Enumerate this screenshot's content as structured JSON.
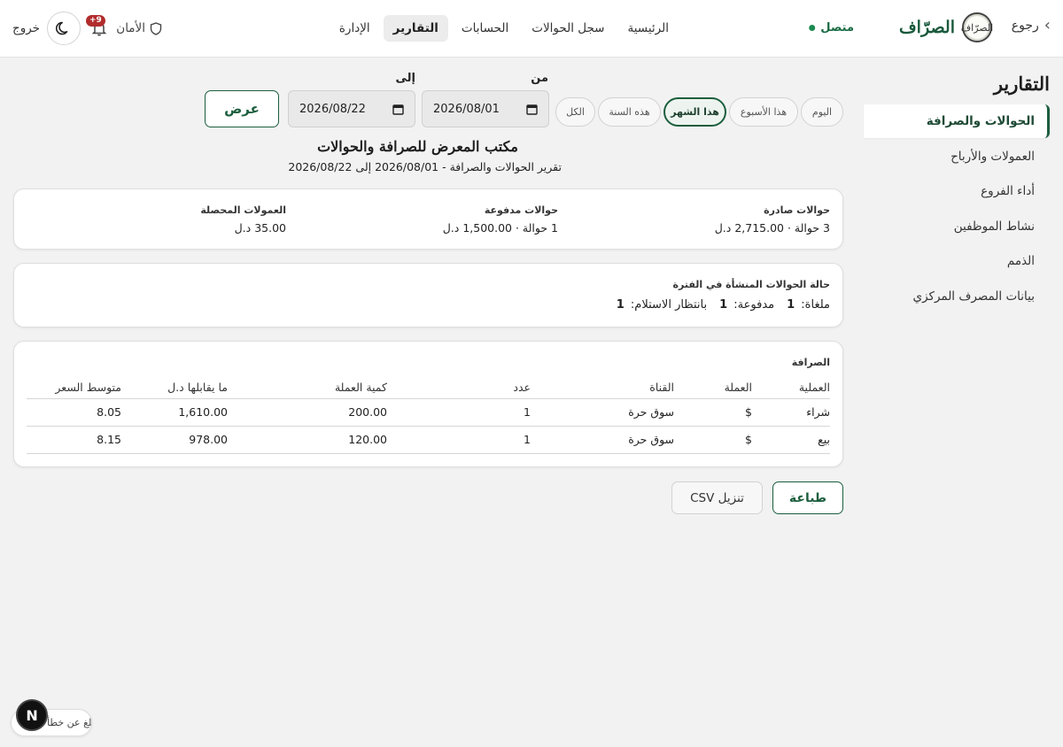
{
  "colors": {
    "brand": "#1c5e3e",
    "online": "#1c8a4f",
    "badge": "#b22c2c",
    "background": "#f2f2f2"
  },
  "topbar": {
    "back_label": "رجوع",
    "back_icon": "chevron-right-icon",
    "logo_text": "الصرّاف",
    "brand_name": "الصرّاف",
    "nav": [
      {
        "label": "الرئيسية"
      },
      {
        "label": "سجل الحوالات"
      },
      {
        "label": "الحسابات"
      },
      {
        "label": "التقارير",
        "active": true
      },
      {
        "label": "الإدارة"
      }
    ],
    "status_label": "متصل",
    "security_label": "الأمان",
    "notifications_badge": "9+",
    "theme_icon": "moon-icon",
    "logout_label": "خروج"
  },
  "sidebar": {
    "title": "التقارير",
    "items": [
      {
        "label": "الحوالات والصرافة",
        "active": true
      },
      {
        "label": "العمولات والأرباح"
      },
      {
        "label": "أداء الفروع"
      },
      {
        "label": "نشاط الموظفين"
      },
      {
        "label": "الذمم"
      },
      {
        "label": "بيانات المصرف المركزي"
      }
    ]
  },
  "filters": {
    "from_label": "من",
    "to_label": "إلى",
    "presets": [
      {
        "label": "اليوم"
      },
      {
        "label": "هذا الأسبوع"
      },
      {
        "label": "هذا الشهر",
        "active": true
      },
      {
        "label": "هذه السنة"
      },
      {
        "label": "الكل"
      }
    ],
    "from_date": "2026/08/01",
    "to_date": "2026/08/22",
    "show_button": "عرض"
  },
  "report": {
    "title": "مكتب المعرض للصرافة والحوالات",
    "subtitle": "تقرير الحوالات والصرافة - 2026/08/01 إلى 2026/08/22"
  },
  "summary": [
    {
      "label": "حوالات صادرة",
      "value": "3 حوالة · 2,715.00 د.ل"
    },
    {
      "label": "حوالات مدفوعة",
      "value": "1 حوالة · 1,500.00 د.ل"
    },
    {
      "label": "العمولات المحصلة",
      "value": "35.00 د.ل"
    }
  ],
  "status_card": {
    "title": "حالة الحوالات المنشأة في الفترة",
    "items": [
      {
        "label": "ملغاة:",
        "value": "1"
      },
      {
        "label": "مدفوعة:",
        "value": "1"
      },
      {
        "label": "بانتظار الاستلام:",
        "value": "1"
      }
    ]
  },
  "exchange": {
    "title": "الصرافة",
    "columns": [
      "العملية",
      "العملة",
      "القناة",
      "عدد",
      "كمية العملة",
      "ما يقابلها د.ل",
      "متوسط السعر"
    ],
    "rows": [
      [
        "شراء",
        "$",
        "سوق حرة",
        "1",
        "200.00",
        "1,610.00",
        "8.05"
      ],
      [
        "بيع",
        "$",
        "سوق حرة",
        "1",
        "120.00",
        "978.00",
        "8.15"
      ]
    ]
  },
  "actions": {
    "print": "طباعة",
    "csv": "تنزيل CSV"
  },
  "floating": {
    "report_issue": "أبلغ عن خطأ",
    "n_badge": "N"
  }
}
